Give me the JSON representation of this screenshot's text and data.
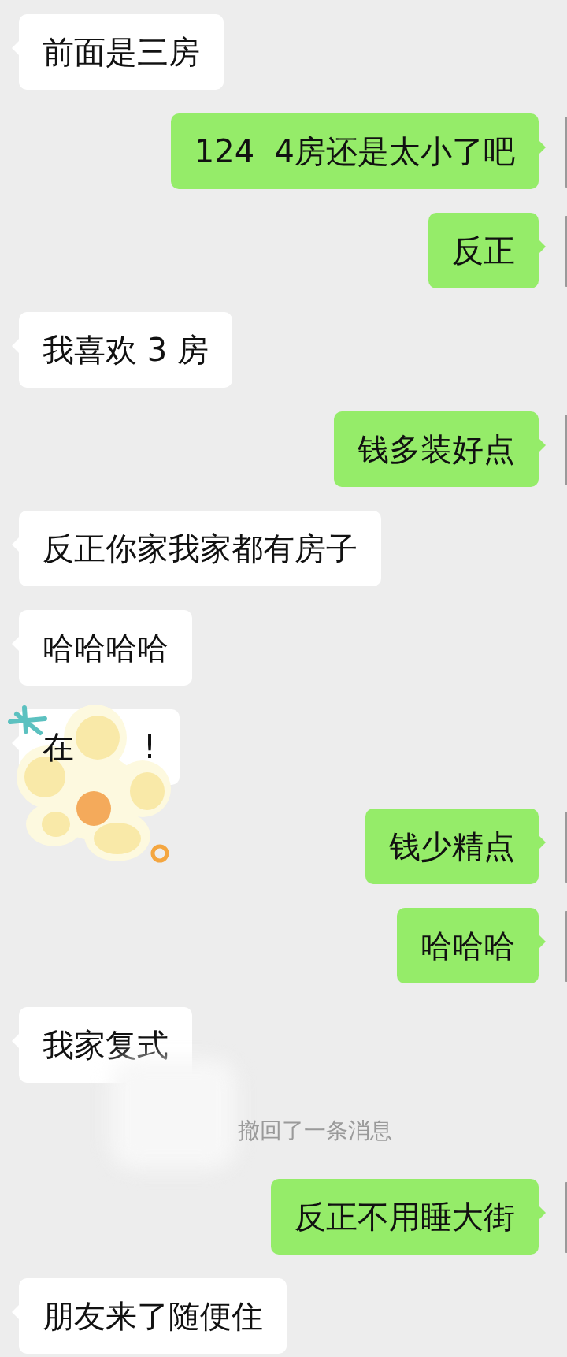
{
  "messages": [
    {
      "sent": false,
      "kind": "text",
      "text": "前面是三房"
    },
    {
      "sent": true,
      "kind": "text",
      "text": "124  4房还是太小了吧"
    },
    {
      "sent": true,
      "kind": "text",
      "text": "反正"
    },
    {
      "sent": false,
      "kind": "text",
      "text": "我喜欢 3 房"
    },
    {
      "sent": true,
      "kind": "text",
      "text": "钱多装好点"
    },
    {
      "sent": false,
      "kind": "text",
      "text": "反正你家我家都有房子"
    },
    {
      "sent": false,
      "kind": "text",
      "text": "哈哈哈哈"
    },
    {
      "sent": false,
      "kind": "covered",
      "parts": [
        "在",
        "!"
      ]
    },
    {
      "sent": true,
      "kind": "text",
      "text": "钱少精点"
    },
    {
      "sent": true,
      "kind": "text",
      "text": "哈哈哈"
    },
    {
      "sent": false,
      "kind": "text",
      "text": "我家复式"
    },
    {
      "kind": "recall",
      "text": "撤回了一条消息"
    },
    {
      "sent": true,
      "kind": "text",
      "text": "反正不用睡大街"
    },
    {
      "sent": false,
      "kind": "text",
      "text": "朋友来了随便住"
    }
  ]
}
